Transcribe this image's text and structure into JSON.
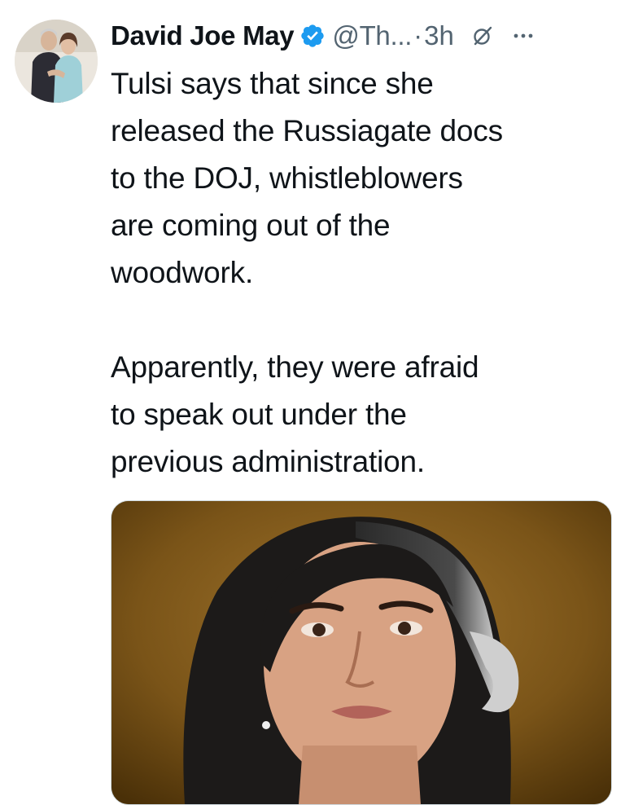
{
  "tweet": {
    "author": {
      "display_name": "David Joe May",
      "handle": "@Th...",
      "verified": true,
      "avatar_icon": "avatar-photo"
    },
    "separator": "·",
    "time": "3h",
    "icons": {
      "verified": "verified-badge-icon",
      "grok": "grok-icon",
      "more": "more-icon"
    },
    "paragraphs": [
      "Tulsi says that since she\nreleased the Russiagate docs\nto the DOJ, whistleblowers\nare coming out of the\nwoodwork.",
      "Apparently, they were afraid\nto speak out under the\nprevious administration."
    ],
    "media": {
      "type": "photo"
    }
  },
  "colors": {
    "text": "#0f1419",
    "secondary": "#536471",
    "verified_blue": "#1d9bf0",
    "background": "#ffffff"
  }
}
